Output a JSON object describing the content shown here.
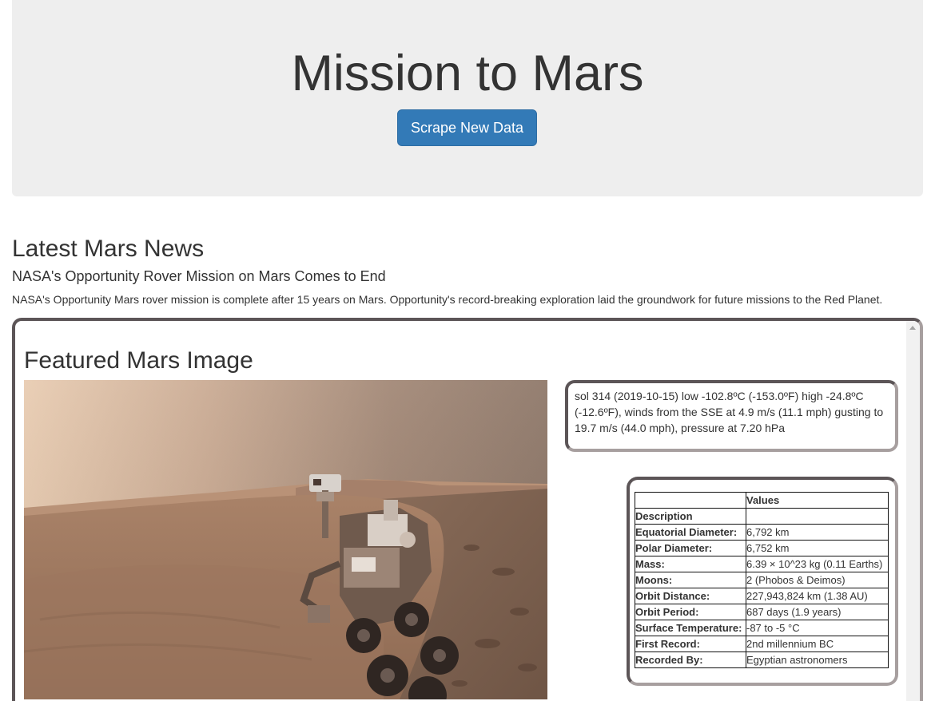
{
  "header": {
    "title": "Mission to Mars",
    "scrape_button": "Scrape New Data"
  },
  "news": {
    "section_title": "Latest Mars News",
    "headline": "NASA's Opportunity Rover Mission on Mars Comes to End",
    "teaser": "NASA's Opportunity Mars rover mission is complete after 15 years on Mars. Opportunity's record-breaking exploration laid the groundwork for future missions to the Red Planet."
  },
  "featured": {
    "title": "Featured Mars Image"
  },
  "weather": {
    "text": "sol 314 (2019-10-15) low -102.8ºC (-153.0ºF) high -24.8ºC (-12.6ºF), winds from the SSE at 4.9 m/s (11.1 mph) gusting to 19.7 m/s (44.0 mph), pressure at 7.20 hPa"
  },
  "facts": {
    "columns": [
      "",
      "Values"
    ],
    "rows": [
      {
        "label": "Description",
        "value": ""
      },
      {
        "label": "Equatorial Diameter:",
        "value": "6,792 km"
      },
      {
        "label": "Polar Diameter:",
        "value": "6,752 km"
      },
      {
        "label": "Mass:",
        "value": "6.39 × 10^23 kg (0.11 Earths)"
      },
      {
        "label": "Moons:",
        "value": "2 (Phobos & Deimos)"
      },
      {
        "label": "Orbit Distance:",
        "value": "227,943,824 km (1.38 AU)"
      },
      {
        "label": "Orbit Period:",
        "value": "687 days (1.9 years)"
      },
      {
        "label": "Surface Temperature:",
        "value": "-87 to -5 °C"
      },
      {
        "label": "First Record:",
        "value": "2nd millennium BC"
      },
      {
        "label": "Recorded By:",
        "value": "Egyptian astronomers"
      }
    ]
  },
  "colors": {
    "accent": "#337ab7",
    "jumbotron_bg": "#eeeeee",
    "frame_border": "#5c5557"
  }
}
